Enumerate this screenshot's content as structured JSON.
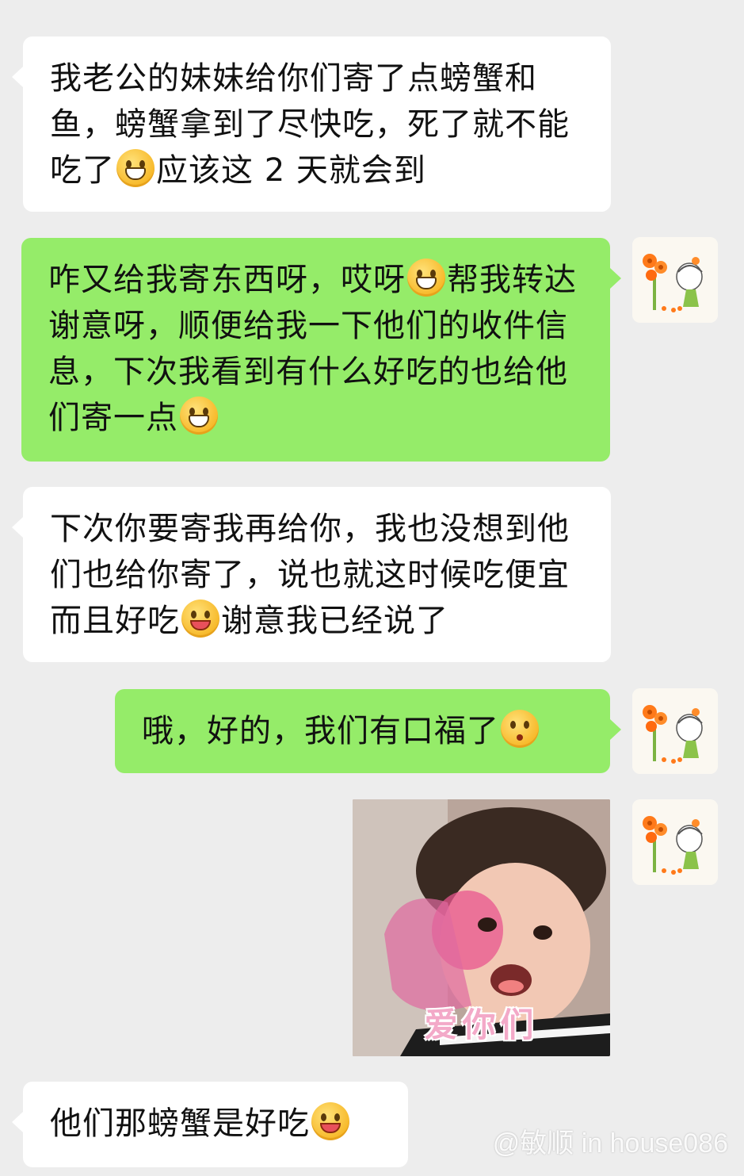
{
  "messages": [
    {
      "side": "left",
      "text_1": "我老公的妹妹给你们寄了点螃蟹和鱼，螃蟹拿到了尽快吃，死了就不能吃了",
      "emoji_1": "grin-emoji",
      "text_2": "应该这 2 天就会到"
    },
    {
      "side": "right",
      "text_1": "咋又给我寄东西呀，哎呀",
      "emoji_1": "crying-laughing-emoji",
      "text_2": "帮我转达谢意呀，顺便给我一下他们的收件信息，下次我看到有什么好吃的也给他们寄一点",
      "emoji_2": "grin-emoji"
    },
    {
      "side": "left",
      "text_1": "下次你要寄我再给你，我也没想到他们也给你寄了，说也就这时候吃便宜而且好吃",
      "emoji_1": "yum-emoji",
      "text_2": "谢意我已经说了"
    },
    {
      "side": "right",
      "text_1": "哦，好的，我们有口福了",
      "emoji_1": "kissing-emoji"
    },
    {
      "side": "right",
      "sticker_caption": "爱你们"
    },
    {
      "side": "left",
      "text_1": "他们那螃蟹是好吃",
      "emoji_1": "yum-emoji"
    }
  ],
  "watermark": "@敏顺 in house086"
}
